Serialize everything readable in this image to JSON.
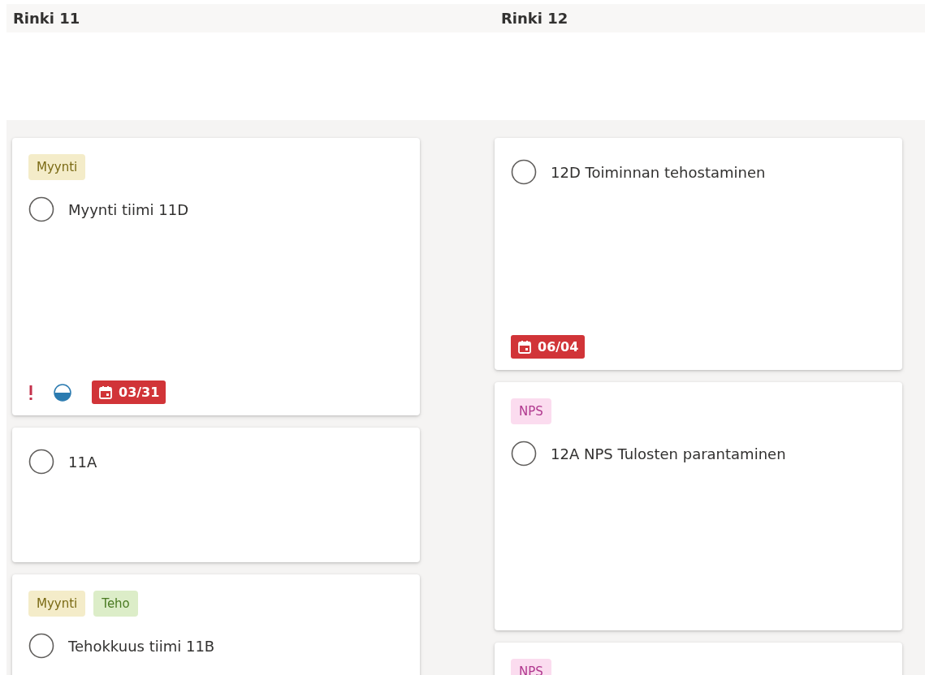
{
  "columns": [
    {
      "title": "Rinki 11",
      "cards": [
        {
          "labels": [
            {
              "text": "Myynti",
              "color": "#f4ecc9"
            }
          ],
          "task": "Myynti tiimi 11D",
          "checked": false,
          "important": true,
          "in_progress": true,
          "due": {
            "text": "03/31",
            "overdue": true
          }
        },
        {
          "task": "11A",
          "checked": false,
          "important": false
        },
        {
          "labels": [
            {
              "text": "Myynti",
              "color": "#f4ecc9"
            },
            {
              "text": "Teho",
              "color": "#dcedc8"
            }
          ],
          "task": "Tehokkuus tiimi 11B",
          "checked": false,
          "important": false
        }
      ]
    },
    {
      "title": "Rinki 12",
      "cards": [
        {
          "task": "12D Toiminnan tehostaminen",
          "checked": false,
          "important": false,
          "due": {
            "text": "06/04",
            "overdue": true
          }
        },
        {
          "labels": [
            {
              "text": "NPS",
              "color": "#fbdcef"
            }
          ],
          "task": "12A NPS Tulosten parantaminen",
          "checked": false,
          "important": false
        },
        {
          "labels": [
            {
              "text": "NPS",
              "color": "#fbdcef"
            }
          ]
        }
      ]
    }
  ]
}
